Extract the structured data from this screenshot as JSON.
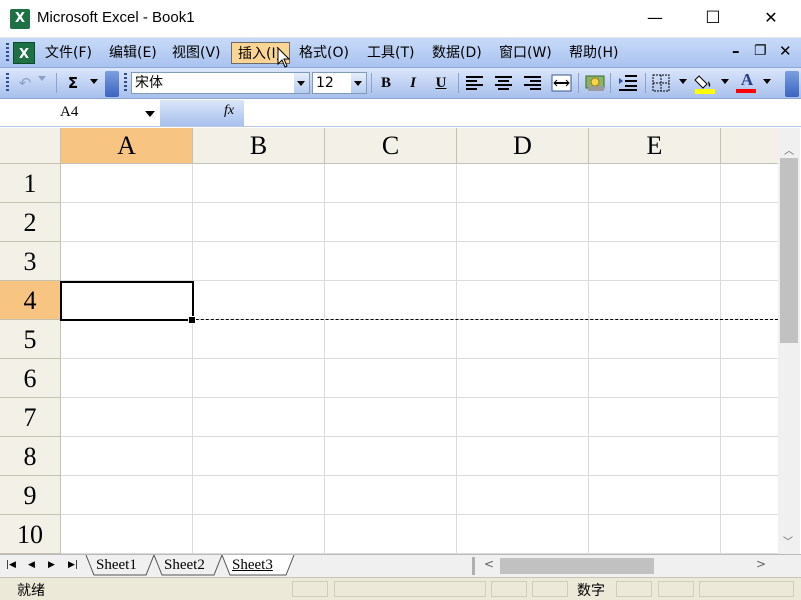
{
  "window": {
    "title": "Microsoft Excel - Book1",
    "controls": {
      "minimize": "—",
      "maximize": "☐",
      "close": "✕"
    }
  },
  "menu": {
    "items": [
      {
        "label": "文件(F)"
      },
      {
        "label": "编辑(E)"
      },
      {
        "label": "视图(V)"
      },
      {
        "label": "插入(I)",
        "active": true
      },
      {
        "label": "格式(O)"
      },
      {
        "label": "工具(T)"
      },
      {
        "label": "数据(D)"
      },
      {
        "label": "窗口(W)"
      },
      {
        "label": "帮助(H)"
      }
    ],
    "doc_controls": {
      "minimize": "–",
      "restore": "❐",
      "close": "✕"
    }
  },
  "toolbar": {
    "undo_icon": "↶",
    "sum_icon": "Σ",
    "font_name": "宋体",
    "font_size": "12",
    "bold": "B",
    "italic": "I",
    "underline": "U",
    "font_color_label": "A",
    "accent_highlight": "#ffff00",
    "accent_font_color": "#ff0000"
  },
  "formula_bar": {
    "name_box": "A4",
    "fx_label": "fx",
    "value": ""
  },
  "grid": {
    "columns": [
      "A",
      "B",
      "C",
      "D",
      "E"
    ],
    "rows": [
      "1",
      "2",
      "3",
      "4",
      "5",
      "6",
      "7",
      "8",
      "9",
      "10"
    ],
    "selected_cell": "A4",
    "selected_column": "A",
    "selected_row": "4",
    "selection_color": "#f8c482"
  },
  "sheets": {
    "tabs": [
      {
        "label": "Sheet1",
        "active": false
      },
      {
        "label": "Sheet2",
        "active": false
      },
      {
        "label": "Sheet3",
        "active": true
      }
    ]
  },
  "status": {
    "left": "就绪",
    "num_mode": "数字"
  }
}
